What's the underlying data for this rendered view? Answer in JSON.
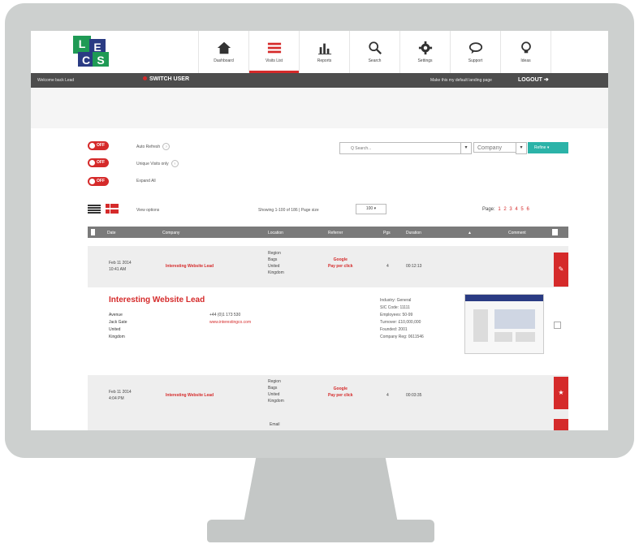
{
  "nav": {
    "items": [
      {
        "label": "Dashboard",
        "icon": "home-icon"
      },
      {
        "label": "Visits List",
        "icon": "list-icon"
      },
      {
        "label": "Reports",
        "icon": "bar-chart-icon"
      },
      {
        "label": "Search",
        "icon": "search-icon"
      },
      {
        "label": "Settings",
        "icon": "gear-icon"
      },
      {
        "label": "Support",
        "icon": "chat-bubble-icon"
      },
      {
        "label": "Ideas",
        "icon": "lightbulb-icon"
      }
    ],
    "active_item": "Visits List"
  },
  "bar": {
    "welcome": "Welcome back Lead",
    "switch": "SWITCH USER",
    "default_page": "Make this my default landing page",
    "logout": "LOGOUT"
  },
  "options": [
    {
      "toggle": "OFF",
      "label": "Auto Refresh"
    },
    {
      "toggle": "OFF",
      "label": "Unique Visits only"
    },
    {
      "toggle": "OFF",
      "label": "Expand All"
    }
  ],
  "search": {
    "placeholder": "Q Search...",
    "filter": "Company",
    "button": "Refine"
  },
  "list": {
    "view_label": "View options",
    "showing": "Showing 1-100 of 186 | Page size",
    "page_size": "100",
    "pager_label": "Page:",
    "pages": [
      "1",
      "2",
      "3",
      "4",
      "5",
      "6"
    ]
  },
  "table": {
    "headers": [
      "Date",
      "Company",
      "Location",
      "Referrer",
      "Pgs",
      "Duration",
      "",
      "Comment"
    ]
  },
  "rows": [
    {
      "date": "Feb 11 2014\n10:41 AM",
      "company": "Interesting Website Lead",
      "location": "Region\nBags\nUnited\nKingdom",
      "referrer": "Google\nPay per click",
      "pages": "4",
      "duration": "00:12:13"
    },
    {
      "date": "Feb 11 2014\n4:04 PM",
      "company": "Interesting Website Lead",
      "location": "Region\nBags\nUnited\nKingdom",
      "referrer": "Google\nPay per click",
      "pages": "4",
      "duration": "00:03:35"
    }
  ],
  "expanded": {
    "title": "Interesting Website Lead",
    "address": "Avenue\nJack Gate\nUnited\nKingdom",
    "phone": "+44 (0)1 173 530",
    "website": "www.interestingco.com",
    "info": [
      "Industry: General",
      "SIC Code: 11111",
      "Employees: 50-99",
      "Turnover: £10,000,000",
      "Founded: 2001",
      "Company Reg: 0611546"
    ]
  },
  "tail_row": {
    "text": "Email"
  },
  "colors": {
    "accent_red": "#d52a2a",
    "teal": "#2bb3a8",
    "dark_bar": "#4d4d4d",
    "logo_green": "#1f9a55",
    "logo_blue": "#2a3b83"
  }
}
